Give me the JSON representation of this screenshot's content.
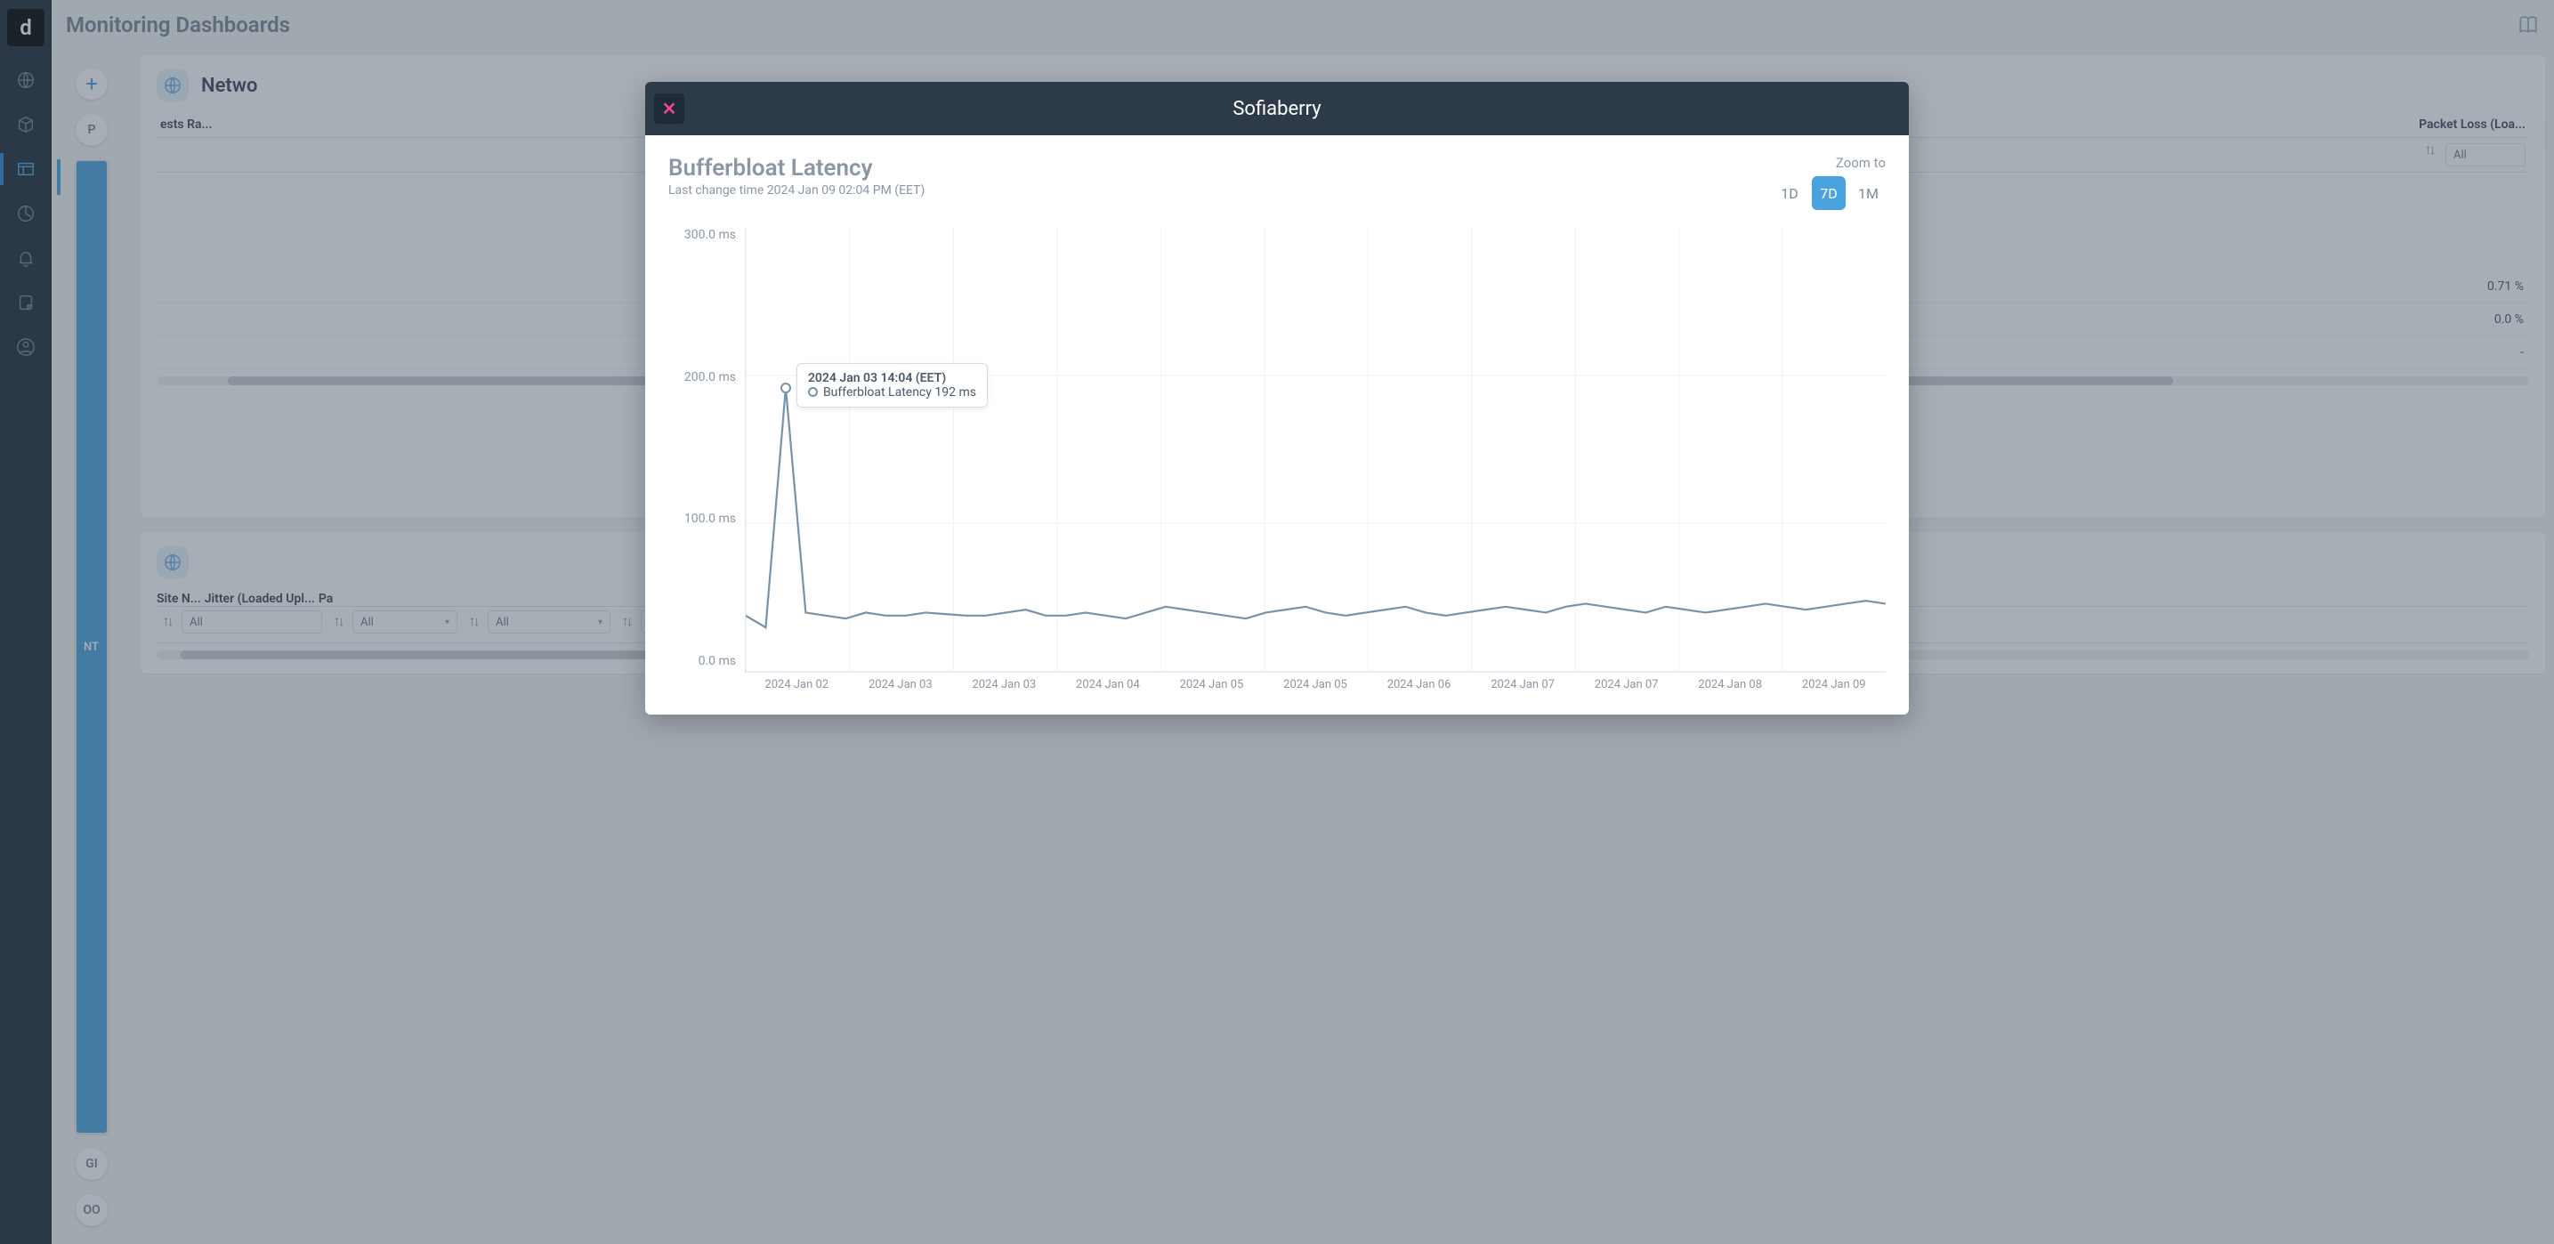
{
  "header": {
    "title": "Monitoring Dashboards"
  },
  "add_monitoring": {
    "label": "Add Monitoring Table"
  },
  "circles": {
    "items": [
      {
        "label": "P",
        "sel": false
      },
      {
        "label": "NT",
        "sel": true
      },
      {
        "label": "GI",
        "sel": false
      },
      {
        "label": "OO",
        "sel": false
      }
    ]
  },
  "panel1": {
    "title": "Netwo",
    "columns": [
      "ests Ra...",
      "Packet Loss (Loa..."
    ],
    "filter_label": "All",
    "rows": [
      {
        "packet_loss": "0.71 %"
      },
      {
        "packet_loss": "0.0 %"
      },
      {
        "packet_loss": "-"
      }
    ]
  },
  "panel2": {
    "columns": [
      "Site N...",
      "",
      "",
      "",
      "",
      "",
      "Jitter (Loaded Upl...",
      "Pa"
    ],
    "filter_label": "All"
  },
  "modal": {
    "title": "Sofiaberry",
    "chart_title": "Bufferbloat Latency",
    "last_change": "Last change time 2024 Jan 09 02:04 PM (EET)",
    "zoom_label": "Zoom to",
    "zoom_opts": [
      "1D",
      "7D",
      "1M"
    ],
    "zoom_active": "7D",
    "tooltip": {
      "time": "2024 Jan 03 14:04 (EET)",
      "series": "Bufferbloat Latency",
      "value": "192 ms"
    }
  },
  "chart_data": {
    "type": "line",
    "title": "Bufferbloat Latency",
    "ylabel": "ms",
    "ylim": [
      0,
      300
    ],
    "y_ticks": [
      "300.0 ms",
      "200.0 ms",
      "100.0 ms",
      "0.0 ms"
    ],
    "x_ticks": [
      "2024 Jan 02",
      "2024 Jan 03",
      "2024 Jan 03",
      "2024 Jan 04",
      "2024 Jan 05",
      "2024 Jan 05",
      "2024 Jan 06",
      "2024 Jan 07",
      "2024 Jan 07",
      "2024 Jan 08",
      "2024 Jan 09"
    ],
    "series": [
      {
        "name": "Bufferbloat Latency",
        "color": "#7892ac",
        "values": [
          38,
          30,
          192,
          40,
          38,
          36,
          40,
          38,
          38,
          40,
          39,
          38,
          38,
          40,
          42,
          38,
          38,
          40,
          38,
          36,
          40,
          44,
          42,
          40,
          38,
          36,
          40,
          42,
          44,
          40,
          38,
          40,
          42,
          44,
          40,
          38,
          40,
          42,
          44,
          42,
          40,
          44,
          46,
          44,
          42,
          40,
          44,
          42,
          40,
          42,
          44,
          46,
          44,
          42,
          44,
          46,
          48,
          46
        ]
      }
    ],
    "highlight_index": 2
  }
}
